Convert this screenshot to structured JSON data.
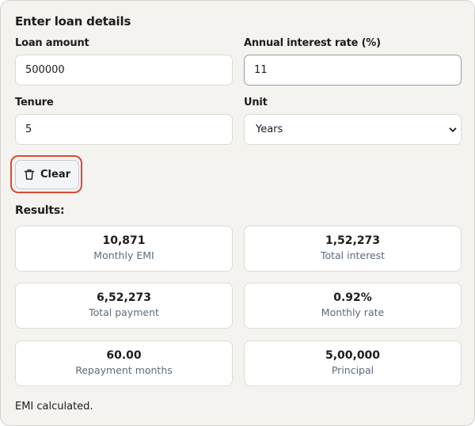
{
  "form": {
    "heading": "Enter loan details",
    "loan_amount": {
      "label": "Loan amount",
      "value": "500000"
    },
    "interest_rate": {
      "label": "Annual interest rate (%)",
      "value": "11"
    },
    "tenure": {
      "label": "Tenure",
      "value": "5"
    },
    "unit": {
      "label": "Unit",
      "selected": "Years"
    },
    "clear_label": "Clear"
  },
  "results": {
    "heading": "Results:",
    "cards": [
      {
        "value": "10,871",
        "caption": "Monthly EMI"
      },
      {
        "value": "1,52,273",
        "caption": "Total interest"
      },
      {
        "value": "6,52,273",
        "caption": "Total payment"
      },
      {
        "value": "0.92%",
        "caption": "Monthly rate"
      },
      {
        "value": "60.00",
        "caption": "Repayment months"
      },
      {
        "value": "5,00,000",
        "caption": "Principal"
      }
    ]
  },
  "status": "EMI calculated.",
  "colors": {
    "panel_bg": "#f5f3ef",
    "focus_ring": "#d94a35",
    "caption": "#5b6b7c"
  },
  "icons": {
    "clear": "trash-icon",
    "unit_select": "chevron-down-icon"
  }
}
